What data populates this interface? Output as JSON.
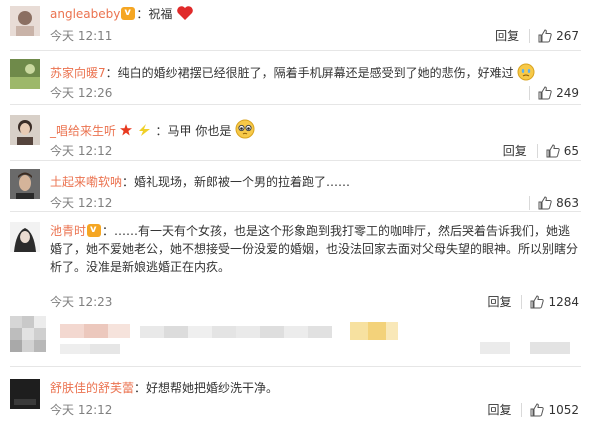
{
  "comments": [
    {
      "user": "angleabeby",
      "text": "：祝福",
      "time": "今天 12:11",
      "reply": "回复",
      "likes": "267"
    },
    {
      "user": "苏家向暖7",
      "text": "：纯白的婚纱裙摆已经很脏了，隔着手机屏幕还是感受到了她的悲伤，好难过",
      "time": "今天 12:26",
      "reply": "回复",
      "likes": "249"
    },
    {
      "user": "_唱给来生听",
      "text": "：马甲 你也是",
      "time": "今天 12:12",
      "reply": "回复",
      "likes": "65"
    },
    {
      "user": "土起来嘞软呐",
      "text": "：婚礼现场，新郎被一个男的拉着跑了……",
      "time": "今天 12:12",
      "reply": "回复",
      "likes": "863"
    },
    {
      "user": "池青时",
      "text": "：……有一天有个女孩，也是这个形象跑到我打零工的咖啡厅，然后哭着告诉我们，她逃婚了，她不爱她老公，她不想接受一份没爱的婚姻，也没法回家去面对父母失望的眼神。所以别瞎分析了。没准是新娘逃婚正在内疚。",
      "time": "今天 12:23",
      "reply": "回复",
      "likes": "1284"
    },
    {
      "user": "舒肤佳的舒芙蕾",
      "text": "：好想帮她把婚纱洗干净。",
      "time": "今天 12:12",
      "reply": "回复",
      "likes": "1052"
    }
  ],
  "colors": {
    "username": "#eb7350",
    "time": "#808080",
    "text": "#333333",
    "divider": "#e6e6e6"
  }
}
